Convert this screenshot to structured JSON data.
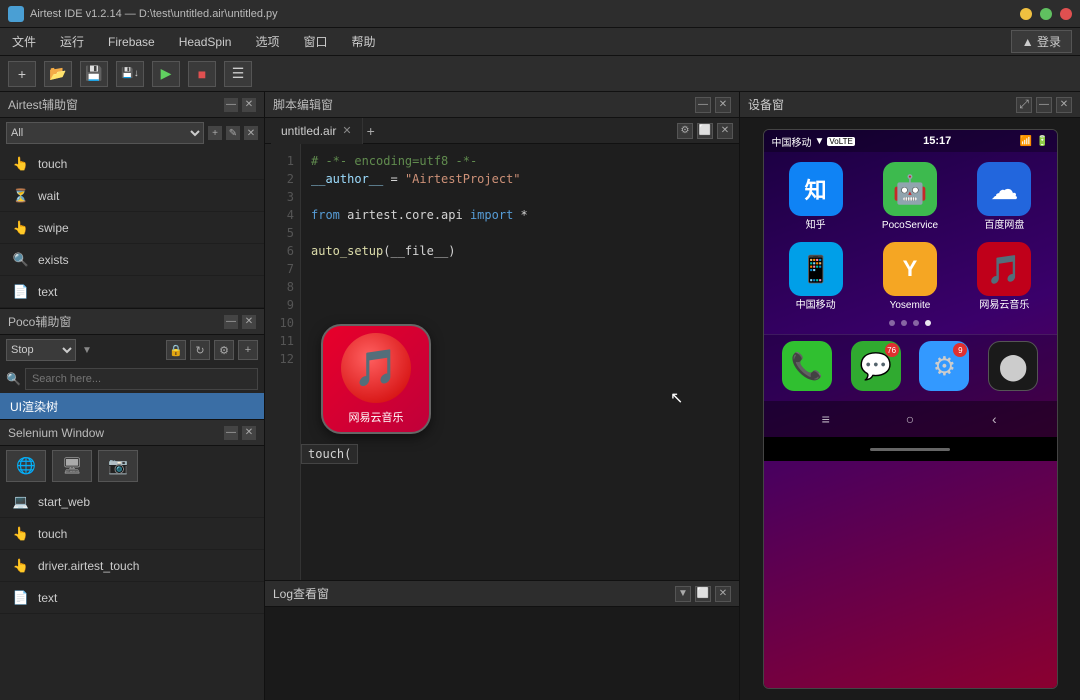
{
  "titlebar": {
    "title": "Airtest IDE v1.2.14 — D:\\test\\untitled.air\\untitled.py",
    "icon_label": "airtest-icon"
  },
  "menubar": {
    "items": [
      "文件",
      "运行",
      "Firebase",
      "HeadSpin",
      "选项",
      "窗口",
      "帮助"
    ],
    "login_label": "▲ 登录"
  },
  "toolbar": {
    "buttons": [
      {
        "name": "new-btn",
        "icon": "+"
      },
      {
        "name": "open-btn",
        "icon": "📂"
      },
      {
        "name": "save-btn",
        "icon": "💾"
      },
      {
        "name": "save-as-btn",
        "icon": "💾"
      },
      {
        "name": "run-btn",
        "icon": "▶"
      },
      {
        "name": "stop-btn",
        "icon": "■"
      },
      {
        "name": "settings-btn",
        "icon": "☰"
      }
    ]
  },
  "left_panel": {
    "airtest_helper": {
      "title": "Airtest辅助窗",
      "dropdown_value": "All",
      "items": [
        {
          "name": "touch",
          "icon": "👆"
        },
        {
          "name": "wait",
          "icon": "⏳"
        },
        {
          "name": "swipe",
          "icon": "👆"
        },
        {
          "name": "exists",
          "icon": "🔍"
        },
        {
          "name": "text",
          "icon": "📄"
        }
      ]
    },
    "poco_helper": {
      "title": "Poco辅助窗",
      "mode_value": "Stop",
      "search_placeholder": "Search here...",
      "tree_item": "UI渲染树"
    },
    "selenium_window": {
      "title": "Selenium Window",
      "tabs": [
        {
          "name": "globe-tab",
          "icon": "🌐"
        },
        {
          "name": "monitor-tab",
          "icon": "🖥"
        },
        {
          "name": "camera-tab",
          "icon": "📷"
        }
      ],
      "items": [
        {
          "name": "start_web",
          "icon": "💻"
        },
        {
          "name": "touch",
          "icon": "👆"
        },
        {
          "name": "driver.airtest_touch",
          "icon": "👆"
        },
        {
          "name": "text",
          "icon": "📄"
        }
      ]
    }
  },
  "editor": {
    "title": "脚本编辑窗",
    "tab_label": "untitled.air",
    "code_lines": [
      {
        "num": 1,
        "content": "# -*- encoding=utf8 -*-"
      },
      {
        "num": 2,
        "content": "__author__ = \"AirtestProject\""
      },
      {
        "num": 3,
        "content": ""
      },
      {
        "num": 4,
        "content": "from airtest.core.api import *"
      },
      {
        "num": 5,
        "content": ""
      },
      {
        "num": 6,
        "content": "auto_setup(__file__)"
      },
      {
        "num": 7,
        "content": ""
      },
      {
        "num": 8,
        "content": ""
      },
      {
        "num": 9,
        "content": ""
      },
      {
        "num": 10,
        "content": ""
      },
      {
        "num": 11,
        "content": ""
      },
      {
        "num": 12,
        "content": ""
      }
    ],
    "app_overlay": {
      "label": "网易云音乐"
    },
    "touch_call": "touch("
  },
  "log_viewer": {
    "title": "Log查看窗"
  },
  "device_panel": {
    "title": "设备窗",
    "phone": {
      "status_bar": {
        "carrier": "中国移动 ▼ VoLTE",
        "time": "15:17",
        "icons": "📶 🔋"
      },
      "apps_row1": [
        {
          "name": "知乎",
          "bg": "#0f83f5",
          "icon": "知"
        },
        {
          "name": "PocoService",
          "bg": "#3dba4e",
          "icon": "🤖"
        },
        {
          "name": "百度网盘",
          "bg": "#2266dd",
          "icon": "☁"
        }
      ],
      "apps_row2": [
        {
          "name": "中国移动",
          "bg": "#009fe8",
          "icon": "📱"
        },
        {
          "name": "Yosemite",
          "bg": "#f5a623",
          "icon": "Y"
        },
        {
          "name": "网易云音乐",
          "bg": "#c0001a",
          "icon": "🎵",
          "badge": ""
        }
      ],
      "dots": [
        false,
        false,
        false,
        true
      ],
      "dock": [
        {
          "name": "phone-app",
          "icon": "📞",
          "bg": "#30c030"
        },
        {
          "name": "messages-app",
          "icon": "💬",
          "bg": "#30aa30",
          "badge": "76"
        },
        {
          "name": "settings-app",
          "icon": "⚙",
          "bg": "#3399ff",
          "badge": "9"
        },
        {
          "name": "camera-app",
          "icon": "⬤",
          "bg": "#1a1a1a"
        }
      ],
      "nav": [
        "≡",
        "○",
        "‹"
      ]
    }
  }
}
